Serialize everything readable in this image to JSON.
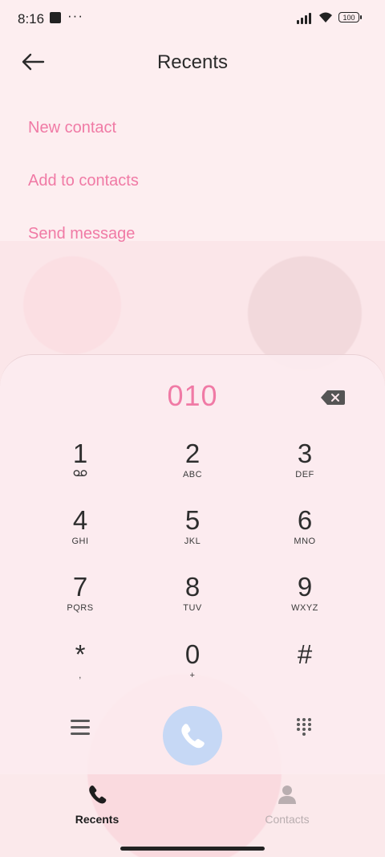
{
  "status_bar": {
    "time": "8:16",
    "notification_dots": "···",
    "battery": "100"
  },
  "header": {
    "title": "Recents"
  },
  "menu": [
    {
      "label": "New contact"
    },
    {
      "label": "Add to contacts"
    },
    {
      "label": "Send message"
    }
  ],
  "dialer": {
    "number": "010",
    "keys": [
      {
        "num": "1",
        "letters": ""
      },
      {
        "num": "2",
        "letters": "ABC"
      },
      {
        "num": "3",
        "letters": "DEF"
      },
      {
        "num": "4",
        "letters": "GHI"
      },
      {
        "num": "5",
        "letters": "JKL"
      },
      {
        "num": "6",
        "letters": "MNO"
      },
      {
        "num": "7",
        "letters": "PQRS"
      },
      {
        "num": "8",
        "letters": "TUV"
      },
      {
        "num": "9",
        "letters": "WXYZ"
      },
      {
        "num": "*",
        "letters": ","
      },
      {
        "num": "0",
        "letters": "+"
      },
      {
        "num": "#",
        "letters": ""
      }
    ]
  },
  "tabs": [
    {
      "label": "Recents",
      "active": true
    },
    {
      "label": "Contacts",
      "active": false
    }
  ],
  "colors": {
    "accent": "#f07aa5",
    "call": "#c6d8f5",
    "text": "#2e2e2e"
  }
}
